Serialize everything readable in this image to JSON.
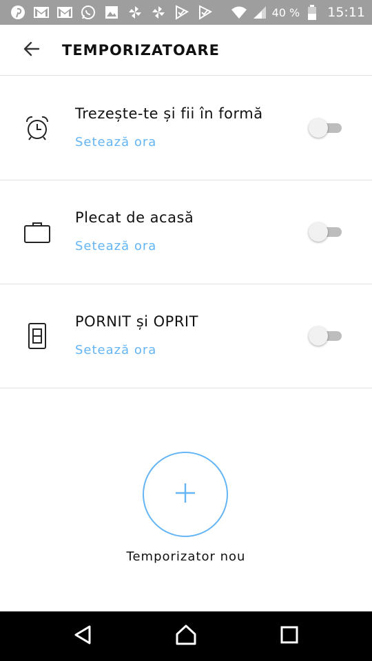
{
  "status_bar": {
    "notification_icons": [
      "pinterest-icon",
      "gmail-icon",
      "gmail-icon",
      "whatsapp-icon",
      "gallery-icon",
      "pinwheel-icon",
      "pinwheel-icon",
      "check-flag-icon",
      "check-flag-icon"
    ],
    "battery_percent": "40 %",
    "time": "15:11"
  },
  "header": {
    "title": "TEMPORIZATOARE"
  },
  "timers": [
    {
      "title": "Trezește-te și fii în formă",
      "link": "Setează ora",
      "icon": "alarm-clock-icon",
      "enabled": false
    },
    {
      "title": "Plecat de acasă",
      "link": "Setează ora",
      "icon": "briefcase-icon",
      "enabled": false
    },
    {
      "title": "PORNIT și OPRIT",
      "link": "Setează ora",
      "icon": "switch-icon",
      "enabled": false
    }
  ],
  "new_timer": {
    "label": "Temporizator nou"
  },
  "colors": {
    "accent": "#64b5f6",
    "status_bar": "#9e9e9e",
    "nav_bar": "#000000",
    "divider": "#e0e0e0"
  }
}
